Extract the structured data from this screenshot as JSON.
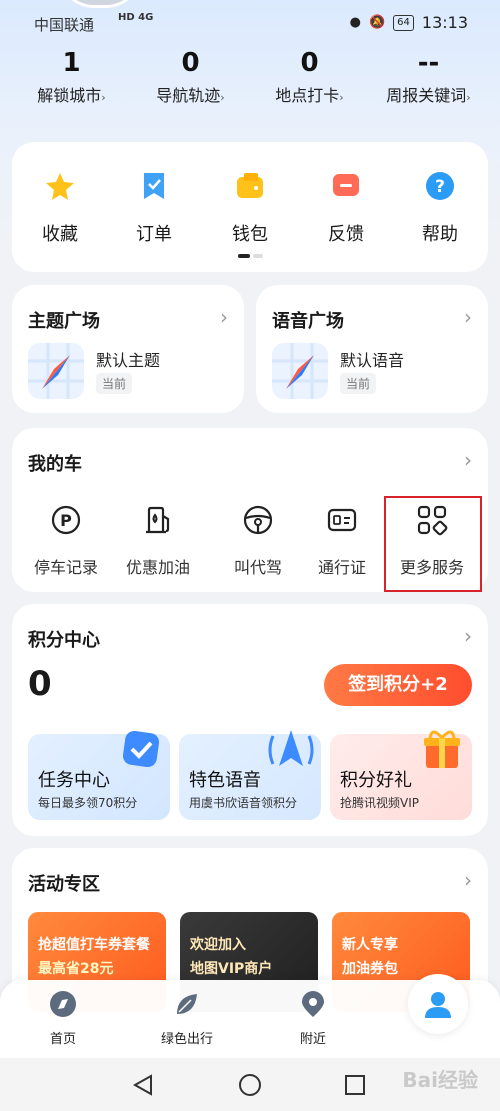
{
  "status_bar": {
    "carrier": "中国联通",
    "network": "HD 4G",
    "battery": "64",
    "time": "13:13"
  },
  "stats": [
    {
      "value": "1",
      "label": "解锁城市"
    },
    {
      "value": "0",
      "label": "导航轨迹"
    },
    {
      "value": "0",
      "label": "地点打卡"
    },
    {
      "value": "--",
      "label": "周报关键词"
    }
  ],
  "quick_actions": [
    {
      "label": "收藏",
      "icon": "star-icon",
      "color": "#ffc21a"
    },
    {
      "label": "订单",
      "icon": "bookmark-order-icon",
      "color": "#3fa2f7"
    },
    {
      "label": "钱包",
      "icon": "wallet-icon",
      "color": "#ffc21a"
    },
    {
      "label": "反馈",
      "icon": "feedback-icon",
      "color": "#ff6b57"
    },
    {
      "label": "帮助",
      "icon": "help-icon",
      "color": "#2a9cf5"
    }
  ],
  "theme_plaza": {
    "title": "主题广场",
    "item": "默认主题",
    "tag": "当前"
  },
  "voice_plaza": {
    "title": "语音广场",
    "item": "默认语音",
    "tag": "当前"
  },
  "my_car": {
    "title": "我的车",
    "items": [
      {
        "label": "停车记录",
        "icon": "parking-icon"
      },
      {
        "label": "优惠加油",
        "icon": "fuel-pump-icon"
      },
      {
        "label": "叫代驾",
        "icon": "steering-wheel-icon"
      },
      {
        "label": "通行证",
        "icon": "id-card-icon"
      },
      {
        "label": "更多服务",
        "icon": "grid-more-icon"
      }
    ]
  },
  "points": {
    "title": "积分中心",
    "value": "0",
    "signin_label": "签到积分+2",
    "cards": [
      {
        "title": "任务中心",
        "sub": "每日最多领70积分"
      },
      {
        "title": "特色语音",
        "sub": "用虞书欣语音领积分"
      },
      {
        "title": "积分好礼",
        "sub": "抢腾讯视频VIP"
      }
    ]
  },
  "activity": {
    "title": "活动专区",
    "banners": [
      {
        "line1": "抢超值打车券套餐",
        "line2": "最高省28元"
      },
      {
        "line1": "欢迎加入",
        "line2": "地图VIP商户"
      },
      {
        "line1": "新人专享",
        "line2": "加油券包"
      }
    ]
  },
  "bottom_nav": [
    {
      "label": "首页",
      "icon": "compass-icon"
    },
    {
      "label": "绿色出行",
      "icon": "leaf-icon"
    },
    {
      "label": "附近",
      "icon": "location-pin-icon"
    }
  ],
  "watermark": "Bai经验"
}
